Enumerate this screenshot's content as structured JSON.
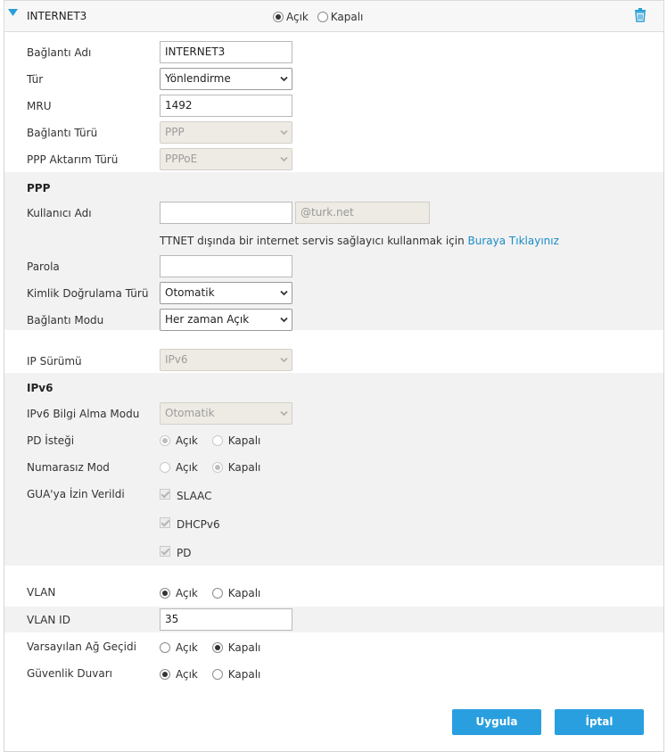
{
  "header": {
    "title": "INTERNET3",
    "on_label": "Açık",
    "off_label": "Kapalı",
    "state": "on"
  },
  "fields": {
    "connection_name": {
      "label": "Bağlantı Adı",
      "value": "INTERNET3"
    },
    "type": {
      "label": "Tür",
      "value": "Yönlendirme"
    },
    "mru": {
      "label": "MRU",
      "value": "1492"
    },
    "connection_type": {
      "label": "Bağlantı Türü",
      "value": "PPP"
    },
    "ppp_transfer_type": {
      "label": "PPP Aktarım Türü",
      "value": "PPPoE"
    }
  },
  "ppp": {
    "section_title": "PPP",
    "username": {
      "label": "Kullanıcı Adı",
      "value": "",
      "suffix": "@turk.net"
    },
    "note_text": "TTNET dışında bir internet servis sağlayıcı kullanmak için ",
    "note_link": "Buraya Tıklayınız",
    "password": {
      "label": "Parola",
      "value": ""
    },
    "auth_type": {
      "label": "Kimlik Doğrulama Türü",
      "value": "Otomatik"
    },
    "connection_mode": {
      "label": "Bağlantı Modu",
      "value": "Her zaman Açık"
    }
  },
  "ip_version": {
    "label": "IP Sürümü",
    "value": "IPv6"
  },
  "ipv6": {
    "section_title": "IPv6",
    "info_mode": {
      "label": "IPv6 Bilgi Alma Modu",
      "value": "Otomatik"
    },
    "pd_request": {
      "label": "PD İsteği",
      "on": "Açık",
      "off": "Kapalı",
      "state": "on"
    },
    "unnumbered": {
      "label": "Numarasız Mod",
      "on": "Açık",
      "off": "Kapalı",
      "state": "off"
    },
    "gua": {
      "label": "GUA'ya İzin Verildi",
      "options": [
        "SLAAC",
        "DHCPv6",
        "PD"
      ]
    }
  },
  "vlan": {
    "label": "VLAN",
    "on": "Açık",
    "off": "Kapalı",
    "state": "on"
  },
  "vlan_id": {
    "label": "VLAN ID",
    "value": "35"
  },
  "default_gateway": {
    "label": "Varsayılan Ağ Geçidi",
    "on": "Açık",
    "off": "Kapalı",
    "state": "off"
  },
  "firewall": {
    "label": "Güvenlik Duvarı",
    "on": "Açık",
    "off": "Kapalı",
    "state": "on"
  },
  "buttons": {
    "apply": "Uygula",
    "cancel": "İptal"
  },
  "colors": {
    "accent": "#2a9fdf",
    "link": "#1a8cc6",
    "band": "#f2f2f2"
  }
}
